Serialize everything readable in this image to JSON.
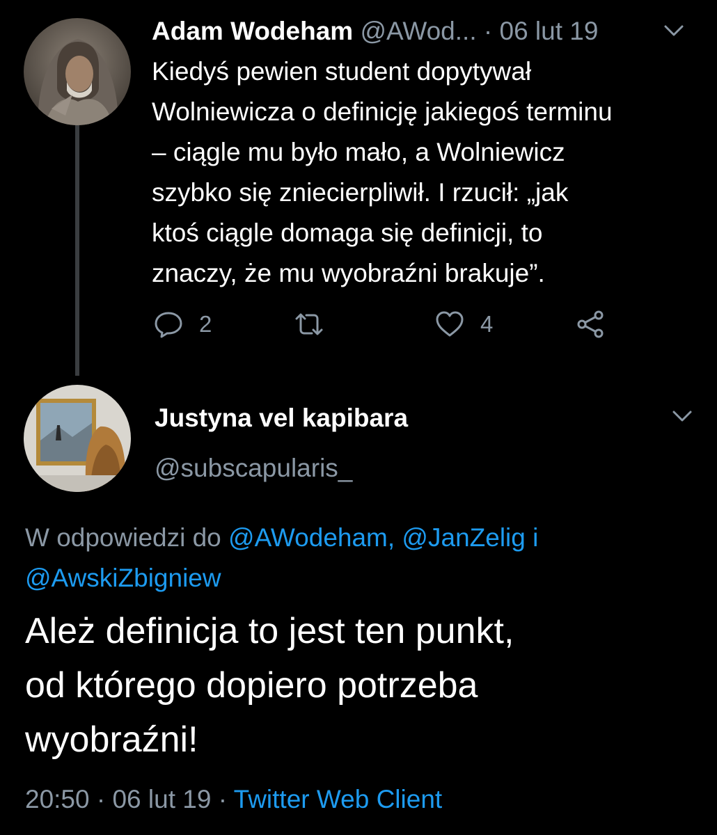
{
  "tweet1": {
    "author_name": "Adam Wodeham",
    "author_handle": "@AWod...",
    "separator": " · ",
    "date": "06 lut 19",
    "text": "Kiedyś pewien student dopytywał\nWolniewicza o definicję jakiegoś terminu\n– ciągle mu było mało, a Wolniewicz\nszybko się zniecierpliwił. I rzucił: „jak\nktoś ciągle domaga się definicji, to\nznaczy, że mu wyobraźni brakuje”.",
    "actions": {
      "reply_count": "2",
      "retweet_count": "",
      "like_count": "4"
    },
    "icons": [
      "avatar-hooded-man",
      "chevron-down-icon",
      "reply-icon",
      "retweet-icon",
      "like-icon",
      "share-icon"
    ]
  },
  "tweet2": {
    "author_name": "Justyna vel kapibara",
    "author_handle": "@subscapularis_",
    "reply_prefix": "W odpowiedzi do ",
    "reply_mentions": "@AWodeham, @JanZelig",
    "reply_conjunction": " i",
    "reply_mention_last": "@AwskiZbigniew",
    "text": "Ależ definicja to jest ten punkt,\nod którego dopiero potrzeba\nwyobraźni!",
    "time": "20:50",
    "separator": " · ",
    "date": "06 lut 19",
    "client": "Twitter Web Client"
  },
  "colors": {
    "background": "#000000",
    "text": "#ffffff",
    "muted": "#8b98a5",
    "link": "#1d9bf0",
    "thread_line": "#3a3d40"
  }
}
